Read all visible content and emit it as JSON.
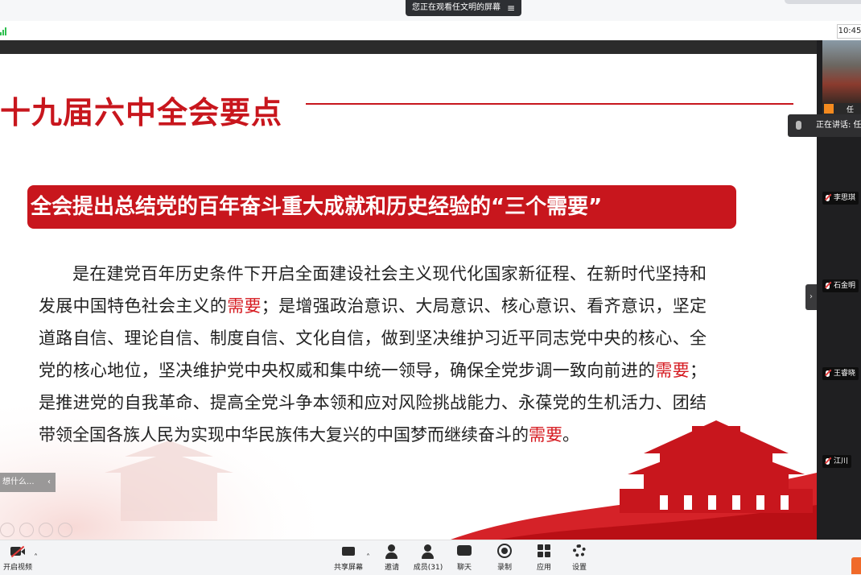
{
  "top": {
    "viewing_text": "您正在观看任文明的屏幕",
    "clock": "10:45"
  },
  "slide": {
    "title": "十九届六中全会要点",
    "banner": "全会提出总结党的百年奋斗重大成就和历史经验的“三个需要”",
    "body": [
      {
        "text": "是在建党百年历史条件下开启全面建设社会主义现代化国家新征程、在新时代坚持和发展中国特色社会主义的",
        "emph": false
      },
      {
        "text": "需要",
        "emph": true
      },
      {
        "text": "；是增强政治意识、大局意识、核心意识、看齐意识，坚定道路自信、理论自信、制度自信、文化自信，做到坚决维护习近平同志党中央的核心、全党的核心地位，坚决维护党中央权威和集中统一领导，确保全党步调一致向前进的",
        "emph": false
      },
      {
        "text": "需要",
        "emph": true
      },
      {
        "text": "；是推进党的自我革命、提高全党斗争本领和应对风险挑战能力、永葆党的生机活力、团结带领全国各族人民为实现中华民族伟大复兴的中国梦而继续奋斗的",
        "emph": false
      },
      {
        "text": "需要",
        "emph": true
      },
      {
        "text": "。",
        "emph": false
      }
    ],
    "side_tab": "想什么..."
  },
  "participants": {
    "speaking": "正在讲话: 任",
    "thumb_name": "任",
    "list": [
      "李思琪",
      "石金明",
      "王睿晓",
      "江川"
    ]
  },
  "toolbar": {
    "video": "开启视频",
    "share": "共享屏幕",
    "invite": "邀请",
    "members": "成员(31)",
    "chat": "聊天",
    "record": "录制",
    "apps": "应用",
    "settings": "设置"
  },
  "colors": {
    "accent_red": "#c8161d",
    "emphasis_red": "#d61b21"
  }
}
